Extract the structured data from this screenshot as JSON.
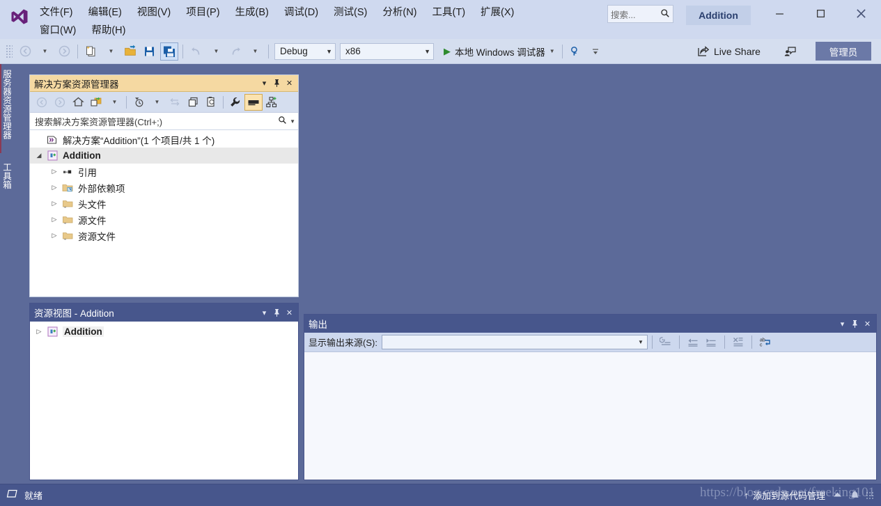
{
  "app": {
    "title": "Addition",
    "logo_icon": "visual-studio-logo"
  },
  "menubar": {
    "items": [
      {
        "label": "文件(F)"
      },
      {
        "label": "编辑(E)"
      },
      {
        "label": "视图(V)"
      },
      {
        "label": "项目(P)"
      },
      {
        "label": "生成(B)"
      },
      {
        "label": "调试(D)"
      },
      {
        "label": "测试(S)"
      },
      {
        "label": "分析(N)"
      },
      {
        "label": "工具(T)"
      },
      {
        "label": "扩展(X)"
      },
      {
        "label": "窗口(W)"
      },
      {
        "label": "帮助(H)"
      }
    ]
  },
  "search": {
    "placeholder": "搜索...",
    "icon": "search-icon"
  },
  "window_controls": {
    "minimize": "—",
    "maximize": "☐",
    "close": "✕"
  },
  "toolbar": {
    "navigate_back": "◀",
    "navigate_forward": "▶",
    "new_item": "new-item-icon",
    "open_file": "open-folder-icon",
    "save": "save-icon",
    "save_all": "save-all-icon",
    "undo": "undo-icon",
    "redo": "redo-icon",
    "config": {
      "value": "Debug"
    },
    "platform": {
      "value": "x86"
    },
    "run": {
      "label": "本地 Windows 调试器"
    },
    "live_share": {
      "label": "Live Share",
      "icon": "live-share-icon"
    },
    "feedback_icon": "feedback-icon",
    "admin_badge": "管理员"
  },
  "vertical_tabs": [
    {
      "label": "服务器资源管理器",
      "id": "server-explorer"
    },
    {
      "label": "工具箱",
      "id": "toolbox"
    }
  ],
  "solution_explorer": {
    "title": "解决方案资源管理器",
    "toolbar": {
      "back": "back-icon",
      "forward": "forward-icon",
      "home": "home-icon",
      "pending_changes": "pending-changes-icon",
      "history": "history-icon",
      "sync": "sync-with-active-icon",
      "show_all_files": "show-all-files-icon",
      "refresh": "refresh-icon",
      "properties": "wrench-icon",
      "preview": "preview-selected-icon",
      "class_view": "class-view-icon"
    },
    "search_placeholder": "搜索解决方案资源管理器(Ctrl+;)",
    "tree": [
      {
        "label": "解决方案“Addition”(1 个项目/共 1 个)",
        "indent": 0,
        "icon": "solution-icon",
        "twisty": "",
        "selected": false,
        "bold": false
      },
      {
        "label": "Addition",
        "indent": 1,
        "icon": "cpp-project-icon",
        "twisty": "expanded",
        "selected": true,
        "bold": true
      },
      {
        "label": "引用",
        "indent": 2,
        "icon": "references-icon",
        "twisty": "collapsed",
        "selected": false,
        "bold": false
      },
      {
        "label": "外部依赖项",
        "indent": 2,
        "icon": "external-deps-icon",
        "twisty": "collapsed",
        "selected": false,
        "bold": false
      },
      {
        "label": "头文件",
        "indent": 2,
        "icon": "folder-filter-icon",
        "twisty": "collapsed",
        "selected": false,
        "bold": false
      },
      {
        "label": "源文件",
        "indent": 2,
        "icon": "folder-filter-icon",
        "twisty": "collapsed",
        "selected": false,
        "bold": false
      },
      {
        "label": "资源文件",
        "indent": 2,
        "icon": "folder-filter-icon",
        "twisty": "collapsed",
        "selected": false,
        "bold": false
      }
    ]
  },
  "resource_view": {
    "title": "资源视图 - Addition",
    "tree": [
      {
        "label": "Addition",
        "indent": 0,
        "icon": "cpp-project-icon",
        "twisty": "collapsed",
        "bold": true
      }
    ]
  },
  "output": {
    "title": "输出",
    "source_label": "显示输出来源(S):",
    "source_value": "",
    "toolbar_icons": [
      "go-to-message-icon",
      "previous-message-icon",
      "next-message-icon",
      "clear-all-icon",
      "toggle-word-wrap-icon"
    ],
    "content": ""
  },
  "panel_chrome": {
    "dropdown": "▾",
    "pin": "⚲",
    "close": "✕"
  },
  "statusbar": {
    "ready_icon": "ready-icon",
    "ready_text": "就绪",
    "source_control_text": "添加到源代码管理",
    "up_arrow": "↑",
    "icons": [
      "publish-icon",
      "notification-bell-icon"
    ]
  },
  "watermark": {
    "text": "https://blog.csdn.net/freeking101"
  },
  "colors": {
    "workspace_bg": "#5c6a99",
    "menubar_bg": "#cfd9ef",
    "toolbar_bg": "#d5deef",
    "panel_header_active": "#f5d9a2",
    "panel_header_inactive": "#47568c",
    "statusbar_bg": "#47568c",
    "accent_purple": "#68217a",
    "run_green": "#2e8b2e"
  }
}
